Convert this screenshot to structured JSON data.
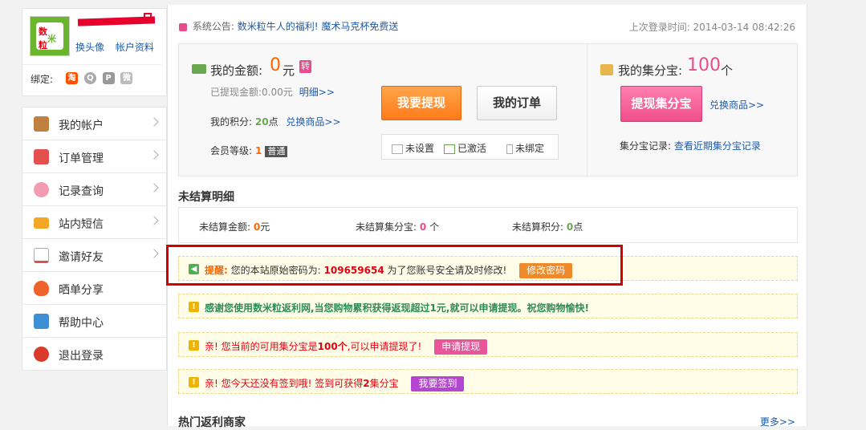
{
  "profile": {
    "avatar_text": [
      "数",
      "米",
      "粒"
    ],
    "links": [
      "换头像",
      "帐户资料"
    ],
    "bind_label": "绑定:",
    "bind_icons": [
      "taobao-icon",
      "qq-icon",
      "p-icon",
      "weibo-icon"
    ]
  },
  "menu": [
    {
      "label": "我的帐户",
      "icon": "user-icon",
      "color": "#c0813f",
      "arrow": true
    },
    {
      "label": "订单管理",
      "icon": "order-icon",
      "color": "#e35050",
      "arrow": true
    },
    {
      "label": "记录查询",
      "icon": "piggy-icon",
      "color": "#f29bb1",
      "arrow": true
    },
    {
      "label": "站内短信",
      "icon": "mail-icon",
      "color": "#f5a623",
      "arrow": true
    },
    {
      "label": "邀请好友",
      "icon": "chart-icon",
      "color": "#d9534f",
      "arrow": true
    },
    {
      "label": "晒单分享",
      "icon": "heart-icon",
      "color": "#f0622b",
      "arrow": false
    },
    {
      "label": "帮助中心",
      "icon": "help-icon",
      "color": "#3d8fd6",
      "arrow": false
    },
    {
      "label": "退出登录",
      "icon": "power-icon",
      "color": "#d93a2b",
      "arrow": false
    }
  ],
  "notice": {
    "label": "系统公告:",
    "link": "数米粒牛人的福利!  魔术马克杯免费送"
  },
  "last_login": "上次登录时间: 2014-03-14 08:42:26",
  "account": {
    "money_label": "我的金额:",
    "money_value": "0",
    "money_unit": "元",
    "transfer_badge": "转",
    "withdrawn_label": "已提现金额:",
    "withdrawn_value": "0.00元",
    "detail_link": "明细>>",
    "points_label": "我的积分:",
    "points_value": "20",
    "points_unit": "点",
    "exchange_link": "兑换商品>>",
    "level_label": "会员等级:",
    "level_value": "1",
    "level_name": "普通",
    "withdraw_btn": "我要提现",
    "orders_btn": "我的订单",
    "status": [
      "未设置",
      "已激活",
      "未绑定"
    ]
  },
  "jifenbao": {
    "label": "我的集分宝:",
    "value": "100",
    "unit": "个",
    "withdraw_btn": "提现集分宝",
    "exchange_link": "兑换商品>>",
    "record_label": "集分宝记录:",
    "record_link": "查看近期集分宝记录"
  },
  "unsettled": {
    "title": "未结算明细",
    "amount_label": "未结算金额:",
    "amount_value": "0",
    "amount_unit": "元",
    "jfb_label": "未结算集分宝:",
    "jfb_value": "0",
    "jfb_unit": "个",
    "points_label": "未结算积分:",
    "points_value": "0",
    "points_unit": "点"
  },
  "tips": {
    "password": {
      "prefix": "提醒:",
      "text": "您的本站原始密码为:",
      "password": "109659654",
      "suffix": "为了您账号安全请及时修改!",
      "button": "修改密码"
    },
    "thanks": "感谢您使用数米粒返利网,当您购物累积获得返现超过1元,就可以申请提现。祝您购物愉快!",
    "jfb": {
      "prefix": "亲! 您当前的可用集分宝是",
      "value": "100个",
      "suffix": ",可以申请提现了!",
      "button": "申请提现"
    },
    "signin": {
      "prefix": "亲! 您今天还没有签到哦! 签到可获得",
      "value": "2",
      "suffix": "集分宝",
      "button": "我要签到"
    }
  },
  "hot": {
    "title": "热门返利商家",
    "more": "更多>>"
  }
}
